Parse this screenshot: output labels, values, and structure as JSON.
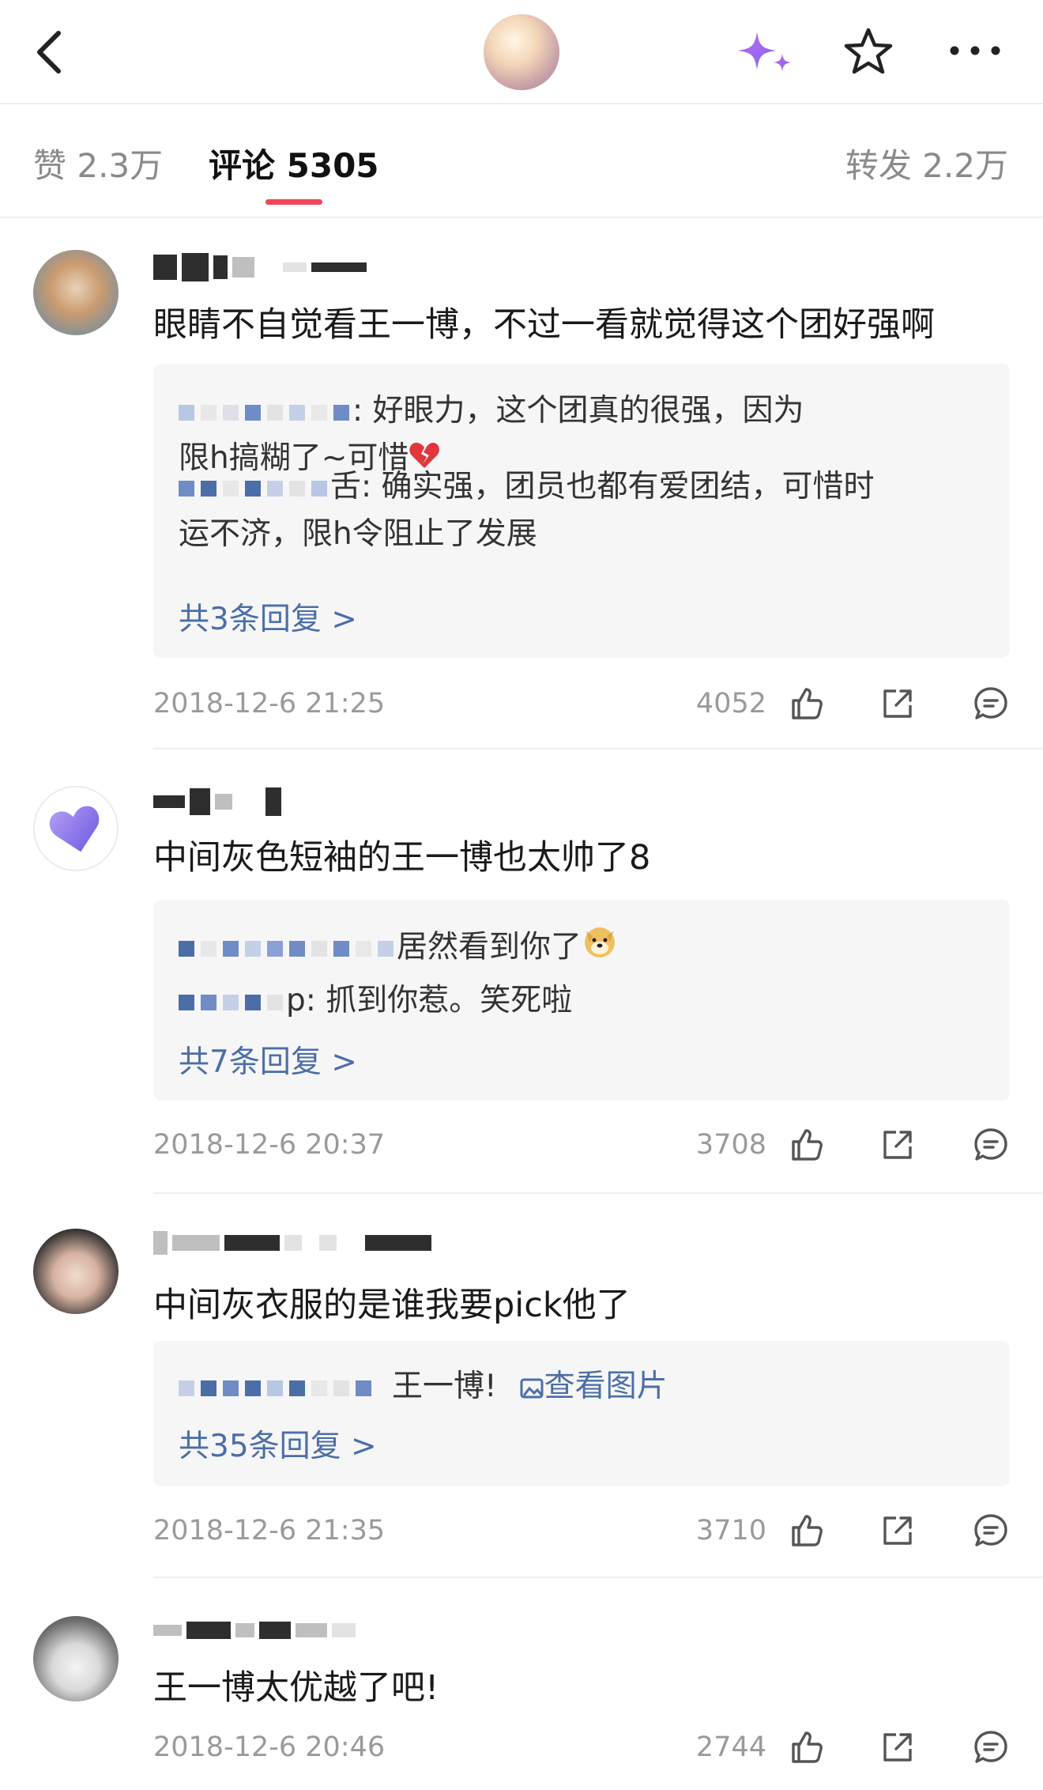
{
  "nav": {
    "back_icon": "chevron-left-icon",
    "sparkle_icon": "sparkle-icon",
    "star_icon": "star-icon",
    "more_icon": "more-icon"
  },
  "tabs": {
    "likes": "赞 2.3万",
    "comments": "评论 5305",
    "reposts": "转发 2.2万",
    "accent": "#f0475c"
  },
  "comments": [
    {
      "text": "眼睛不自觉看王一博，不过一看就觉得这个团好强啊",
      "replies": [
        {
          "line1": ": 好眼力，这个团真的很强，因为",
          "line2": "限h搞糊了~可惜",
          "emoji": "broken-heart-icon"
        },
        {
          "line1": "舌: 确实强，团员也都有爱团结，可惜时",
          "line2": "运不济，限h令阻止了发展"
        }
      ],
      "more": "共3条回复 >",
      "time": "2018-12-6 21:25",
      "likes": "4052"
    },
    {
      "text": "中间灰色短袖的王一博也太帅了8",
      "replies": [
        {
          "line1": "居然看到你了",
          "emoji": "doge-icon"
        },
        {
          "line1": "p: 抓到你惹。笑死啦"
        }
      ],
      "more": "共7条回复 >",
      "time": "2018-12-6 20:37",
      "likes": "3708"
    },
    {
      "text": "中间灰衣服的是谁我要pick他了",
      "replies": [
        {
          "line1": "王一博!",
          "link": "查看图片"
        }
      ],
      "more": "共35条回复 >",
      "time": "2018-12-6 21:35",
      "likes": "3710"
    },
    {
      "text": "王一博太优越了吧!",
      "time": "2018-12-6 20:46",
      "likes": "2744"
    }
  ]
}
